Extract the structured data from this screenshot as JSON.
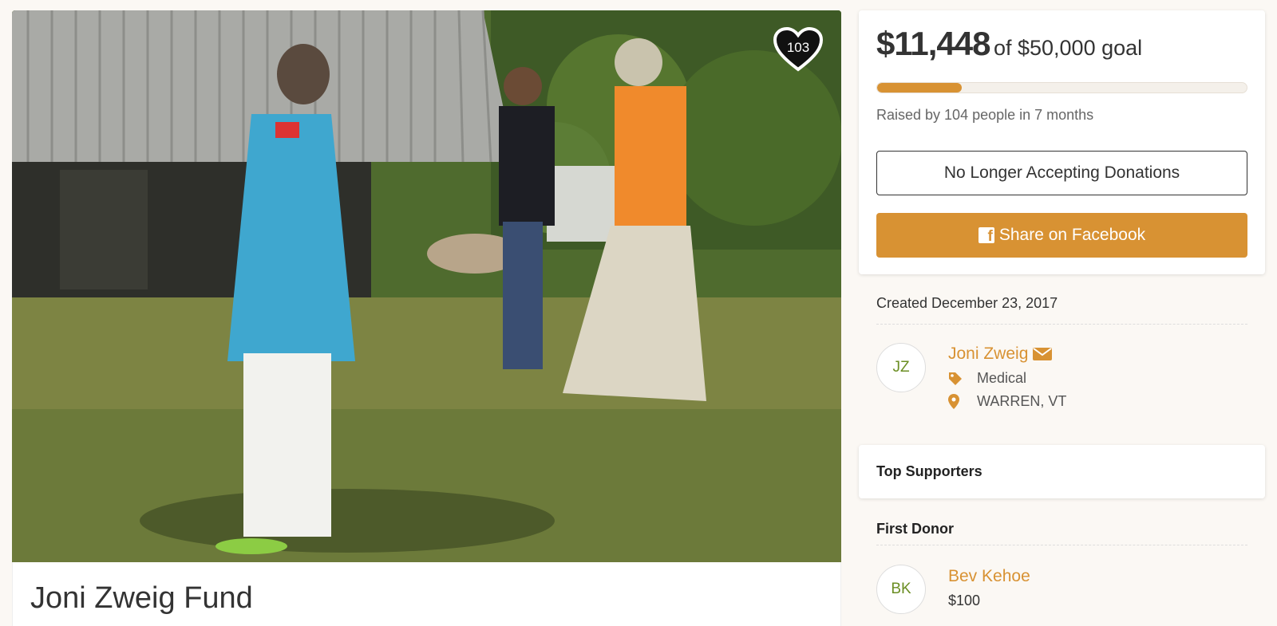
{
  "campaign": {
    "title": "Joni Zweig Fund",
    "hearts": "103"
  },
  "donation": {
    "raised": "$11,448",
    "goal_text": "of $50,000 goal",
    "progress_fraction": 0.229,
    "raised_by": "Raised by 104 people in 7 months",
    "closed_label": "No Longer Accepting Donations",
    "share_label": "Share on Facebook"
  },
  "details": {
    "created": "Created December 23, 2017",
    "organizer": {
      "initials": "JZ",
      "name": "Joni Zweig",
      "category": "Medical",
      "location": "WARREN, VT"
    }
  },
  "supporters": {
    "heading": "Top Supporters",
    "first_donor_label": "First Donor",
    "first_donor": {
      "initials": "BK",
      "name": "Bev Kehoe",
      "amount": "$100"
    }
  },
  "colors": {
    "accent": "#d89233",
    "avatar_text": "#6b8e23",
    "page_bg": "#fbf8f4"
  },
  "icons": {
    "heart": "heart-icon",
    "facebook": "facebook-icon",
    "mail": "envelope-icon",
    "tag": "tag-icon",
    "location": "map-marker-icon"
  }
}
